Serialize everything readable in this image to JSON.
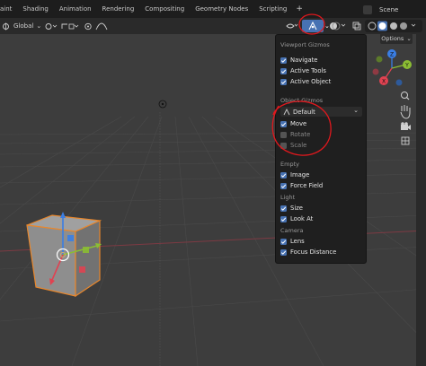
{
  "top_tabs": [
    "aint",
    "Shading",
    "Animation",
    "Rendering",
    "Compositing",
    "Geometry Nodes",
    "Scripting"
  ],
  "add_tab": "+",
  "scene": "Scene",
  "header": {
    "orientation": "Global"
  },
  "options_label": "Options",
  "popup": {
    "viewport_gizmos_header": "Viewport Gizmos",
    "navigate": "Navigate",
    "active_tools": "Active Tools",
    "active_object": "Active Object",
    "object_gizmos_header": "Object Gizmos",
    "orientation_value": "Default",
    "move": "Move",
    "rotate": "Rotate",
    "scale": "Scale",
    "empty_header": "Empty",
    "image": "Image",
    "force_field": "Force Field",
    "light_header": "Light",
    "size": "Size",
    "look_at": "Look At",
    "camera_header": "Camera",
    "lens": "Lens",
    "focus_distance": "Focus Distance"
  },
  "gizmo_axes": {
    "x": "X",
    "y": "Y",
    "z": "Z"
  },
  "colors": {
    "accent": "#4772b3",
    "annotation_red": "#e0181d",
    "x_axis": "#e04251",
    "y_axis": "#8bbd33",
    "z_axis": "#3a7ee4",
    "selection": "#e8872c"
  }
}
